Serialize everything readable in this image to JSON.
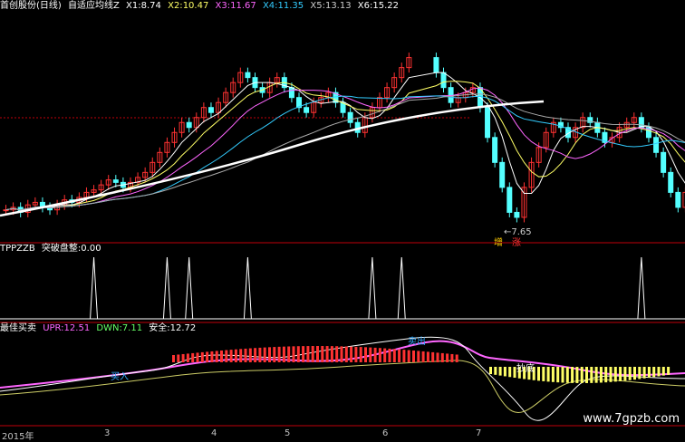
{
  "header_main": {
    "title": "首创股份(日线)",
    "indicator_name": "自适应均线Z",
    "series": [
      {
        "label": "X1:",
        "value": "8.74",
        "color": "#ffffff"
      },
      {
        "label": "X2:",
        "value": "10.47",
        "color": "#ffff66"
      },
      {
        "label": "X3:",
        "value": "11.67",
        "color": "#ff66ff"
      },
      {
        "label": "X4:",
        "value": "11.35",
        "color": "#33ccff"
      },
      {
        "label": "X5:",
        "value": "13.13",
        "color": "#cccccc"
      },
      {
        "label": "X6:",
        "value": "15.22",
        "color": "#ffffff"
      }
    ]
  },
  "header_breakout": {
    "title": "TPPZZB",
    "label": "突破盘整:",
    "value": "0.00"
  },
  "header_trade": {
    "title": "最佳买卖",
    "items": [
      {
        "label": "UPR:",
        "value": "12.51",
        "color": "#ff66ff"
      },
      {
        "label": "DWN:",
        "value": "7.11",
        "color": "#66ff66"
      },
      {
        "label": "安全:",
        "value": "12.72",
        "color": "#ffffff"
      }
    ]
  },
  "annotations": {
    "low_price": "←7.65",
    "zeng_chi": "增",
    "zhang": "涨",
    "chao_di": "抄底",
    "mai_chu": "卖出",
    "mai_ru": "买入"
  },
  "dates": {
    "year": "2015年",
    "m3": "3",
    "m4": "4",
    "m5": "5",
    "m6": "6",
    "m7": "7"
  },
  "watermark": "www.7gpzb.com",
  "colors": {
    "up": "#ff3232",
    "down": "#54ffff",
    "panel_line": "#c0000a",
    "bg": "#000000"
  },
  "chart_data": [
    {
      "type": "candlestick",
      "title": "首创股份(日线)",
      "ma_labels": [
        "X1",
        "X2",
        "X3",
        "X4",
        "X5",
        "X6"
      ],
      "ma_values": [
        8.74,
        10.47,
        11.67,
        11.35,
        13.13,
        15.22
      ],
      "ylim": [
        7,
        16
      ],
      "price_low_annotation": 7.65,
      "close": [
        8.1,
        8.2,
        8.0,
        8.3,
        8.4,
        8.2,
        8.1,
        8.3,
        8.5,
        8.4,
        8.6,
        8.8,
        8.9,
        9.1,
        9.3,
        9.2,
        9.0,
        9.2,
        9.4,
        9.6,
        10.0,
        10.4,
        10.8,
        11.2,
        11.6,
        11.4,
        11.8,
        12.2,
        12.0,
        12.4,
        12.8,
        13.2,
        13.6,
        13.4,
        13.0,
        12.8,
        13.2,
        13.4,
        13.0,
        12.6,
        12.2,
        12.0,
        12.4,
        12.6,
        12.8,
        12.4,
        12.0,
        11.6,
        11.2,
        11.8,
        12.2,
        12.6,
        13.0,
        13.4,
        13.8,
        14.2,
        13.6,
        13.0,
        12.4,
        12.6,
        12.8,
        13.0,
        12.2,
        11.0,
        10.0,
        9.0,
        8.0,
        7.8,
        9.0,
        10.0,
        10.6,
        11.2,
        11.6,
        11.4,
        11.0,
        11.4,
        11.8,
        11.6,
        11.2,
        10.8,
        11.0,
        11.4,
        11.6,
        11.8,
        11.4,
        11.0,
        10.4,
        9.6,
        8.8,
        8.2,
        8.8
      ]
    },
    {
      "type": "line",
      "title": "TPPZZB",
      "series": [
        {
          "name": "突破盘整",
          "peaks_at": [
            12,
            22,
            25,
            33,
            50,
            54,
            84
          ]
        }
      ],
      "value": 0.0
    },
    {
      "type": "line",
      "title": "最佳买卖",
      "series": [
        {
          "name": "UPR",
          "value": 12.51
        },
        {
          "name": "DWN",
          "value": 7.11
        },
        {
          "name": "安全",
          "value": 12.72
        }
      ]
    }
  ]
}
